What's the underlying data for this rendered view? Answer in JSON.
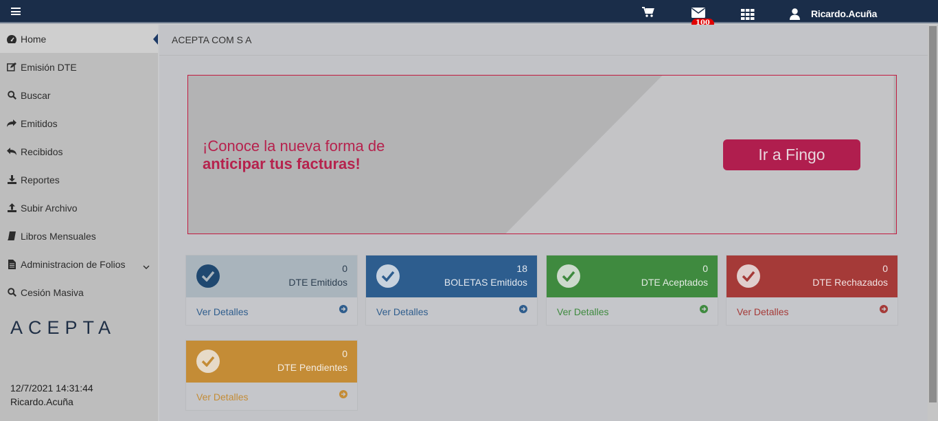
{
  "topbar": {
    "menu_icon": "hamburger-icon",
    "cart_icon": "cart-icon",
    "mail_icon": "envelope-icon",
    "mail_badge": "100",
    "apps_icon": "grid-icon",
    "user_icon": "user-icon",
    "username": "Ricardo.Acuña"
  },
  "sidebar": {
    "items": [
      {
        "label": "Home",
        "icon": "dashboard-icon"
      },
      {
        "label": "Emisión DTE",
        "icon": "edit-icon"
      },
      {
        "label": "Buscar",
        "icon": "search-icon"
      },
      {
        "label": "Emitidos",
        "icon": "share-icon"
      },
      {
        "label": "Recibidos",
        "icon": "reply-icon"
      },
      {
        "label": "Reportes",
        "icon": "download-icon"
      },
      {
        "label": "Subir Archivo",
        "icon": "upload-icon"
      },
      {
        "label": "Libros Mensuales",
        "icon": "book-icon"
      },
      {
        "label": "Administracion de Folios",
        "icon": "file-icon"
      },
      {
        "label": "Cesión Masiva",
        "icon": "search-icon"
      }
    ],
    "logo": "ACEPTA",
    "datetime": "12/7/2021 14:31:44",
    "user": "Ricardo.Acuña"
  },
  "main": {
    "company": "ACEPTA COM S A",
    "banner": {
      "line1": "¡Conoce la nueva forma de",
      "line2": "anticipar tus facturas!",
      "button": "Ir a Fingo"
    },
    "cards": [
      {
        "count": "0",
        "label": "DTE Emitidos",
        "link": "Ver Detalles",
        "color": "#a9b4bc"
      },
      {
        "count": "18",
        "label": "BOLETAS Emitidos",
        "link": "Ver Detalles",
        "color": "#2d5d8e"
      },
      {
        "count": "0",
        "label": "DTE Aceptados",
        "link": "Ver Detalles",
        "color": "#3f8a3f"
      },
      {
        "count": "0",
        "label": "DTE Rechazados",
        "link": "Ver Detalles",
        "color": "#a53a38"
      },
      {
        "count": "0",
        "label": "DTE Pendientes",
        "link": "Ver Detalles",
        "color": "#c48c36"
      }
    ]
  }
}
